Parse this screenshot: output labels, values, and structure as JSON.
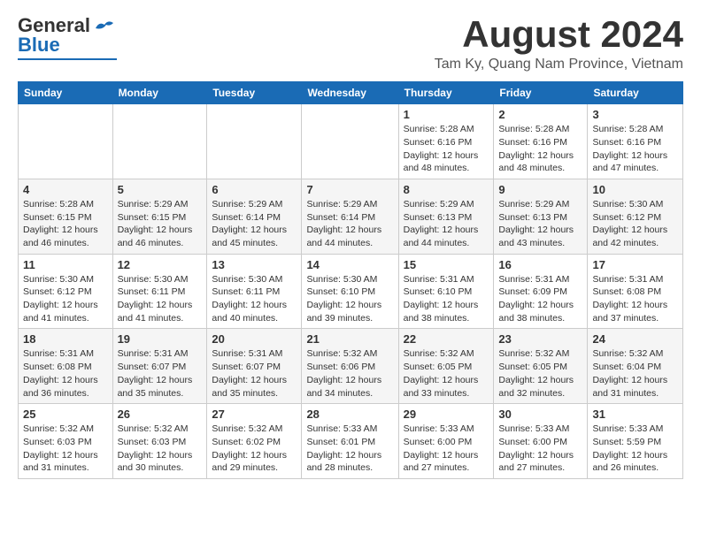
{
  "header": {
    "logo_general": "General",
    "logo_blue": "Blue",
    "month_year": "August 2024",
    "location": "Tam Ky, Quang Nam Province, Vietnam"
  },
  "weekdays": [
    "Sunday",
    "Monday",
    "Tuesday",
    "Wednesday",
    "Thursday",
    "Friday",
    "Saturday"
  ],
  "weeks": [
    [
      {
        "day": "",
        "info": ""
      },
      {
        "day": "",
        "info": ""
      },
      {
        "day": "",
        "info": ""
      },
      {
        "day": "",
        "info": ""
      },
      {
        "day": "1",
        "info": "Sunrise: 5:28 AM\nSunset: 6:16 PM\nDaylight: 12 hours\nand 48 minutes."
      },
      {
        "day": "2",
        "info": "Sunrise: 5:28 AM\nSunset: 6:16 PM\nDaylight: 12 hours\nand 48 minutes."
      },
      {
        "day": "3",
        "info": "Sunrise: 5:28 AM\nSunset: 6:16 PM\nDaylight: 12 hours\nand 47 minutes."
      }
    ],
    [
      {
        "day": "4",
        "info": "Sunrise: 5:28 AM\nSunset: 6:15 PM\nDaylight: 12 hours\nand 46 minutes."
      },
      {
        "day": "5",
        "info": "Sunrise: 5:29 AM\nSunset: 6:15 PM\nDaylight: 12 hours\nand 46 minutes."
      },
      {
        "day": "6",
        "info": "Sunrise: 5:29 AM\nSunset: 6:14 PM\nDaylight: 12 hours\nand 45 minutes."
      },
      {
        "day": "7",
        "info": "Sunrise: 5:29 AM\nSunset: 6:14 PM\nDaylight: 12 hours\nand 44 minutes."
      },
      {
        "day": "8",
        "info": "Sunrise: 5:29 AM\nSunset: 6:13 PM\nDaylight: 12 hours\nand 44 minutes."
      },
      {
        "day": "9",
        "info": "Sunrise: 5:29 AM\nSunset: 6:13 PM\nDaylight: 12 hours\nand 43 minutes."
      },
      {
        "day": "10",
        "info": "Sunrise: 5:30 AM\nSunset: 6:12 PM\nDaylight: 12 hours\nand 42 minutes."
      }
    ],
    [
      {
        "day": "11",
        "info": "Sunrise: 5:30 AM\nSunset: 6:12 PM\nDaylight: 12 hours\nand 41 minutes."
      },
      {
        "day": "12",
        "info": "Sunrise: 5:30 AM\nSunset: 6:11 PM\nDaylight: 12 hours\nand 41 minutes."
      },
      {
        "day": "13",
        "info": "Sunrise: 5:30 AM\nSunset: 6:11 PM\nDaylight: 12 hours\nand 40 minutes."
      },
      {
        "day": "14",
        "info": "Sunrise: 5:30 AM\nSunset: 6:10 PM\nDaylight: 12 hours\nand 39 minutes."
      },
      {
        "day": "15",
        "info": "Sunrise: 5:31 AM\nSunset: 6:10 PM\nDaylight: 12 hours\nand 38 minutes."
      },
      {
        "day": "16",
        "info": "Sunrise: 5:31 AM\nSunset: 6:09 PM\nDaylight: 12 hours\nand 38 minutes."
      },
      {
        "day": "17",
        "info": "Sunrise: 5:31 AM\nSunset: 6:08 PM\nDaylight: 12 hours\nand 37 minutes."
      }
    ],
    [
      {
        "day": "18",
        "info": "Sunrise: 5:31 AM\nSunset: 6:08 PM\nDaylight: 12 hours\nand 36 minutes."
      },
      {
        "day": "19",
        "info": "Sunrise: 5:31 AM\nSunset: 6:07 PM\nDaylight: 12 hours\nand 35 minutes."
      },
      {
        "day": "20",
        "info": "Sunrise: 5:31 AM\nSunset: 6:07 PM\nDaylight: 12 hours\nand 35 minutes."
      },
      {
        "day": "21",
        "info": "Sunrise: 5:32 AM\nSunset: 6:06 PM\nDaylight: 12 hours\nand 34 minutes."
      },
      {
        "day": "22",
        "info": "Sunrise: 5:32 AM\nSunset: 6:05 PM\nDaylight: 12 hours\nand 33 minutes."
      },
      {
        "day": "23",
        "info": "Sunrise: 5:32 AM\nSunset: 6:05 PM\nDaylight: 12 hours\nand 32 minutes."
      },
      {
        "day": "24",
        "info": "Sunrise: 5:32 AM\nSunset: 6:04 PM\nDaylight: 12 hours\nand 31 minutes."
      }
    ],
    [
      {
        "day": "25",
        "info": "Sunrise: 5:32 AM\nSunset: 6:03 PM\nDaylight: 12 hours\nand 31 minutes."
      },
      {
        "day": "26",
        "info": "Sunrise: 5:32 AM\nSunset: 6:03 PM\nDaylight: 12 hours\nand 30 minutes."
      },
      {
        "day": "27",
        "info": "Sunrise: 5:32 AM\nSunset: 6:02 PM\nDaylight: 12 hours\nand 29 minutes."
      },
      {
        "day": "28",
        "info": "Sunrise: 5:33 AM\nSunset: 6:01 PM\nDaylight: 12 hours\nand 28 minutes."
      },
      {
        "day": "29",
        "info": "Sunrise: 5:33 AM\nSunset: 6:00 PM\nDaylight: 12 hours\nand 27 minutes."
      },
      {
        "day": "30",
        "info": "Sunrise: 5:33 AM\nSunset: 6:00 PM\nDaylight: 12 hours\nand 27 minutes."
      },
      {
        "day": "31",
        "info": "Sunrise: 5:33 AM\nSunset: 5:59 PM\nDaylight: 12 hours\nand 26 minutes."
      }
    ]
  ]
}
